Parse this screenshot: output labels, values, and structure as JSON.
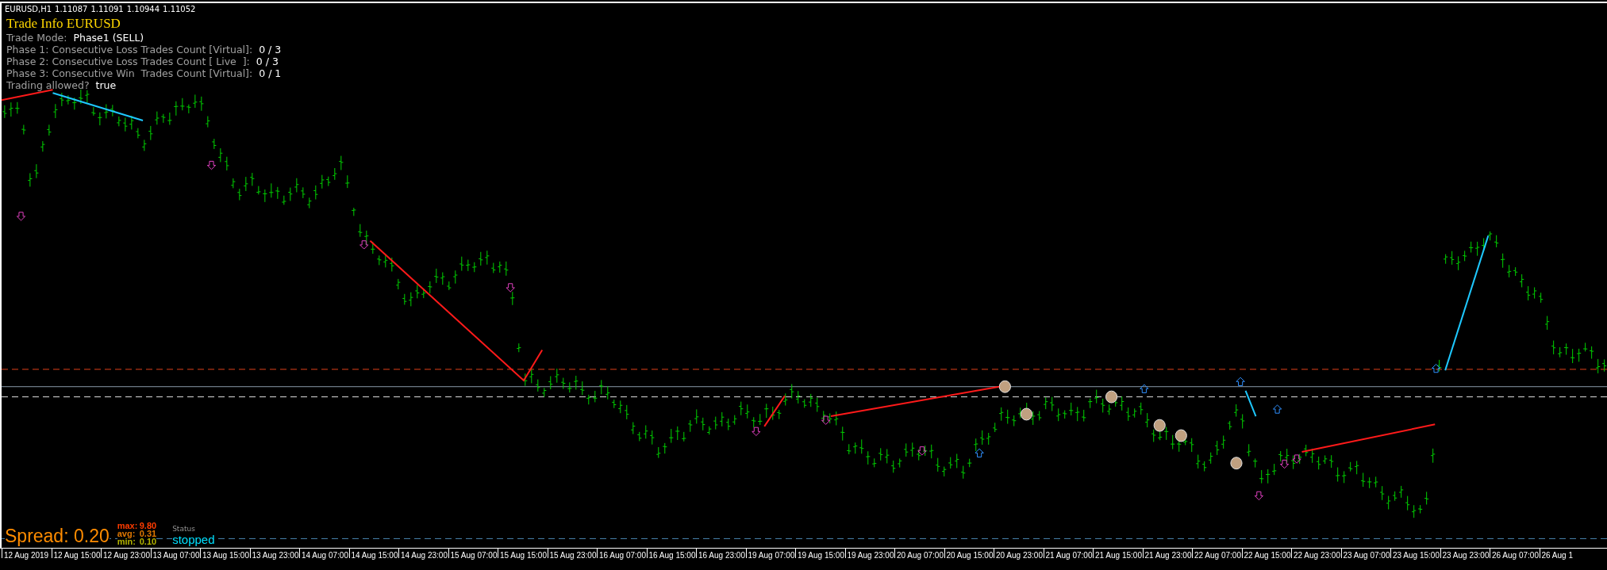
{
  "chart_header": {
    "symbol": "EURUSD,H1",
    "quotes": [
      "1.11087",
      "1.11091",
      "1.10944",
      "1.11052"
    ]
  },
  "info_panel": {
    "title": "Trade Info EURUSD",
    "rows": [
      {
        "label": "Trade Mode:",
        "value": "Phase1 (SELL)"
      },
      {
        "label": "Phase 1: Consecutive Loss Trades Count [Virtual]:",
        "value": "0 / 3"
      },
      {
        "label": "Phase 2: Consecutive Loss Trades Count [ Live  ]:",
        "value": "0 / 3"
      },
      {
        "label": "Phase 3: Consecutive Win  Trades Count [Virtual]:",
        "value": "0 / 1"
      },
      {
        "label": "Trading allowed?",
        "value": "true"
      }
    ]
  },
  "spread_panel": {
    "spread": "Spread: 0.20",
    "stats": [
      {
        "label": "max:",
        "value": "9.80",
        "color": "#ff3c00"
      },
      {
        "label": "avg:",
        "value": "0.31",
        "color": "#e07800"
      },
      {
        "label": "min:",
        "value": "0.10",
        "color": "#b4b400"
      }
    ],
    "status_label": "Status",
    "status": "stopped"
  },
  "time_axis": [
    "12 Aug 2019",
    "12 Aug 15:00",
    "12 Aug 23:00",
    "13 Aug 07:00",
    "13 Aug 15:00",
    "13 Aug 23:00",
    "14 Aug 07:00",
    "14 Aug 15:00",
    "14 Aug 23:00",
    "15 Aug 07:00",
    "15 Aug 15:00",
    "15 Aug 23:00",
    "16 Aug 07:00",
    "16 Aug 15:00",
    "16 Aug 23:00",
    "19 Aug 07:00",
    "19 Aug 15:00",
    "19 Aug 23:00",
    "20 Aug 07:00",
    "20 Aug 15:00",
    "20 Aug 23:00",
    "21 Aug 07:00",
    "21 Aug 15:00",
    "21 Aug 23:00",
    "22 Aug 07:00",
    "22 Aug 15:00",
    "22 Aug 23:00",
    "23 Aug 07:00",
    "23 Aug 15:00",
    "23 Aug 23:00",
    "26 Aug 07:00",
    "26 Aug 1"
  ]
}
